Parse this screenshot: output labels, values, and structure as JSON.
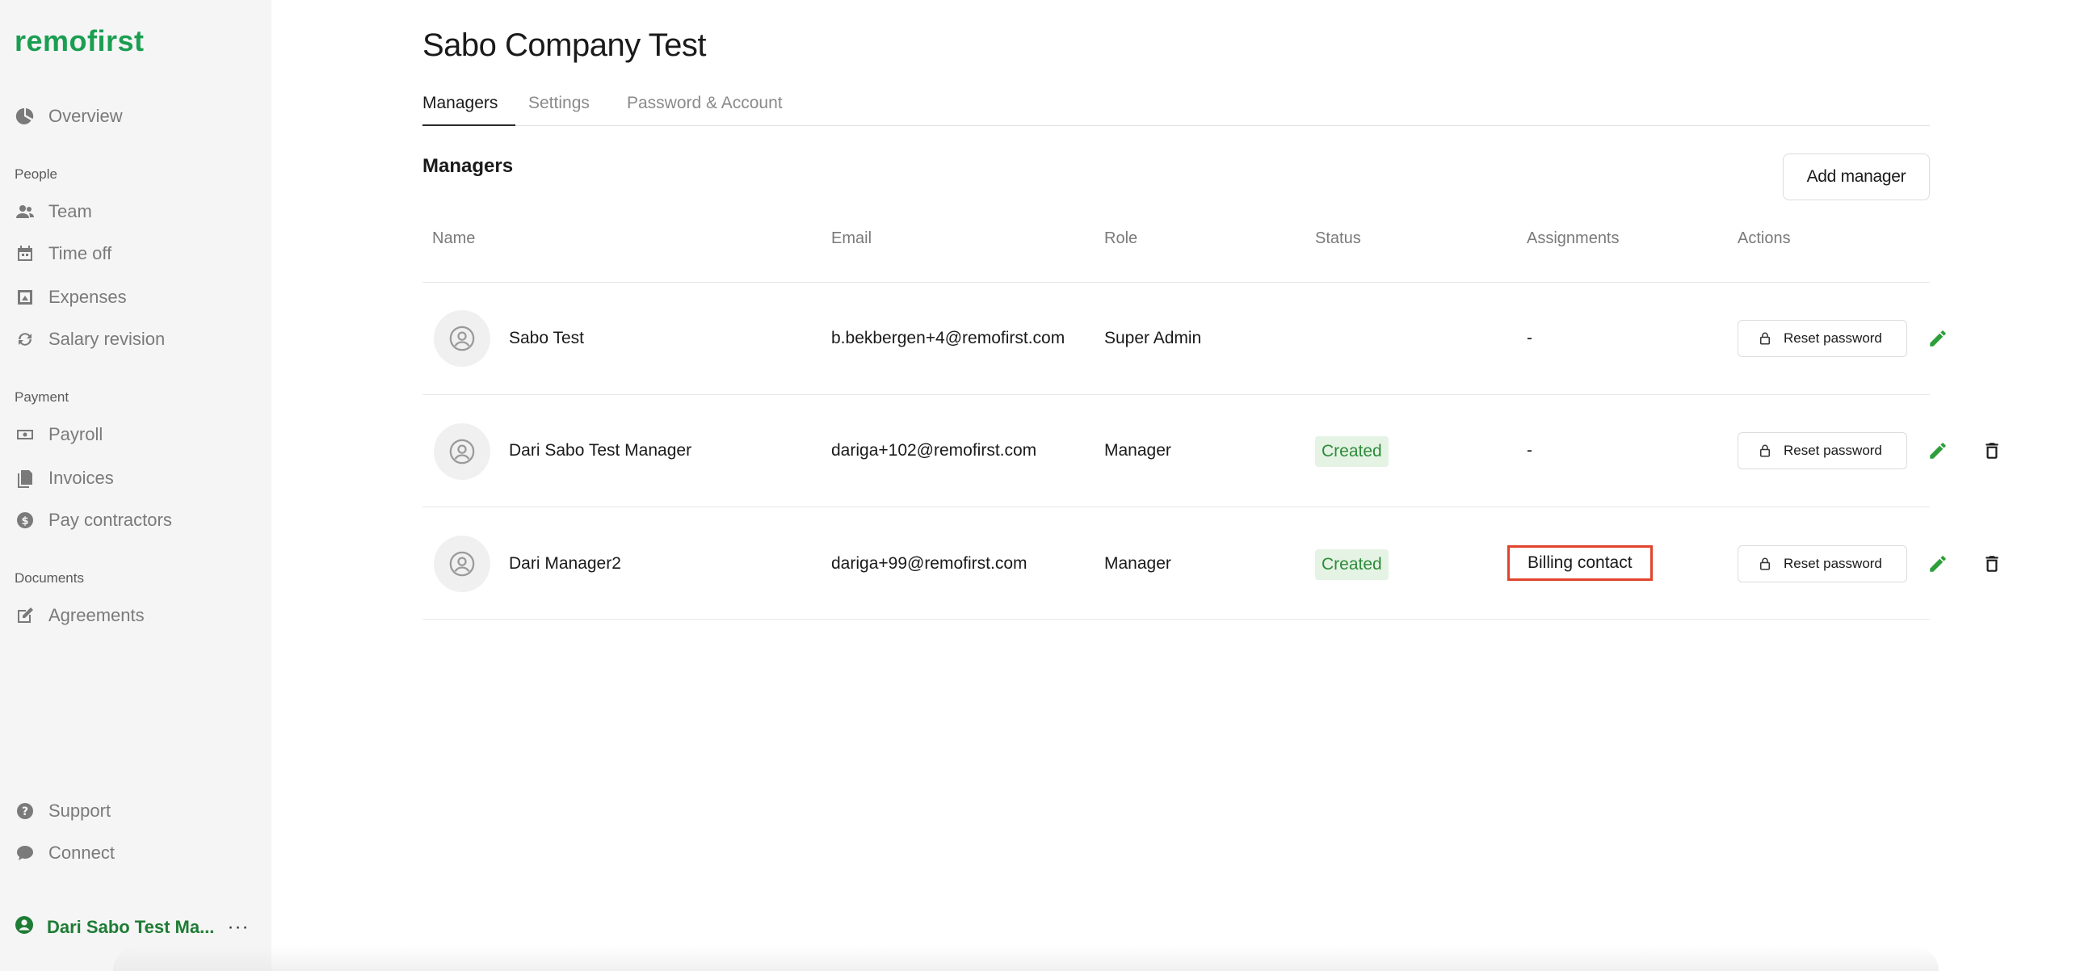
{
  "brand": {
    "logo_text": "remofirst",
    "color": "#1a9e52"
  },
  "sidebar": {
    "overview": {
      "label": "Overview",
      "icon": "pie-chart-icon"
    },
    "sections": [
      {
        "label": "People"
      },
      {
        "label": "Payment"
      },
      {
        "label": "Documents"
      }
    ],
    "items": [
      {
        "label": "Team",
        "icon": "people-icon"
      },
      {
        "label": "Time off",
        "icon": "calendar-icon"
      },
      {
        "label": "Expenses",
        "icon": "receipt-icon"
      },
      {
        "label": "Salary revision",
        "icon": "refresh-icon"
      },
      {
        "label": "Payroll",
        "icon": "money-icon"
      },
      {
        "label": "Invoices",
        "icon": "documents-icon"
      },
      {
        "label": "Pay contractors",
        "icon": "dollar-icon"
      },
      {
        "label": "Agreements",
        "icon": "edit-icon"
      }
    ],
    "support": {
      "label": "Support",
      "icon": "help-icon"
    },
    "connect": {
      "label": "Connect",
      "icon": "chat-icon"
    },
    "user": {
      "label": "Dari Sabo Test Ma...",
      "more": "···",
      "color": "#1e7c34"
    }
  },
  "page": {
    "title": "Sabo Company Test",
    "tabs": [
      {
        "label": "Managers",
        "active": true
      },
      {
        "label": "Settings",
        "active": false
      },
      {
        "label": "Password & Account",
        "active": false
      }
    ],
    "section_title": "Managers",
    "add_button": "Add manager"
  },
  "table": {
    "headers": [
      "Name",
      "Email",
      "Role",
      "Status",
      "Assignments",
      "Actions"
    ],
    "rows": [
      {
        "name": "Sabo Test",
        "email": "b.bekbergen+4@remofirst.com",
        "role": "Super Admin",
        "status": "",
        "assignment": "-",
        "reset_label": "Reset password",
        "deletable": false
      },
      {
        "name": "Dari Sabo Test Manager",
        "email": "dariga+102@remofirst.com",
        "role": "Manager",
        "status": "Created",
        "assignment": "-",
        "reset_label": "Reset password",
        "deletable": true
      },
      {
        "name": "Dari Manager2",
        "email": "dariga+99@remofirst.com",
        "role": "Manager",
        "status": "Created",
        "assignment": "Billing contact",
        "reset_label": "Reset password",
        "deletable": true,
        "highlighted": true
      }
    ]
  },
  "colors": {
    "accent": "#1a9e52",
    "status_bg": "#e4f3e4",
    "status_text": "#2e8b3a",
    "highlight": "#e0442c"
  }
}
